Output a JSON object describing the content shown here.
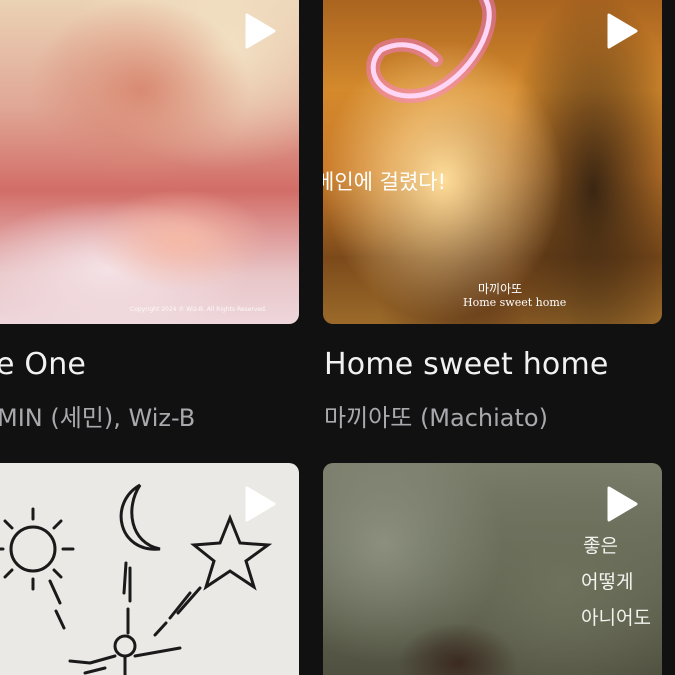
{
  "cards": [
    {
      "title": "e One",
      "artist": "MIN (세민), Wiz-B",
      "art_copyright": "Copyright 2024 ℗ Wiz-B. All Rights Reserved."
    },
    {
      "title": "Home sweet home",
      "artist": "마끼아또 (Machiato)",
      "art_overlay": "메인에 걸렸다!",
      "art_text_korean": "마끼아또",
      "art_text_english": "Home sweet home"
    },
    {
      "title": "",
      "artist": ""
    },
    {
      "title": "",
      "artist": "",
      "art_text_lines": [
        "좋은",
        "어떻게",
        "아니어도"
      ]
    }
  ],
  "icons": {
    "play": "play-icon"
  },
  "colors": {
    "background": "#111112",
    "title_text": "#f2f2f2",
    "artist_text": "#a9a9ad",
    "neon_pink": "#ff5ad8"
  }
}
